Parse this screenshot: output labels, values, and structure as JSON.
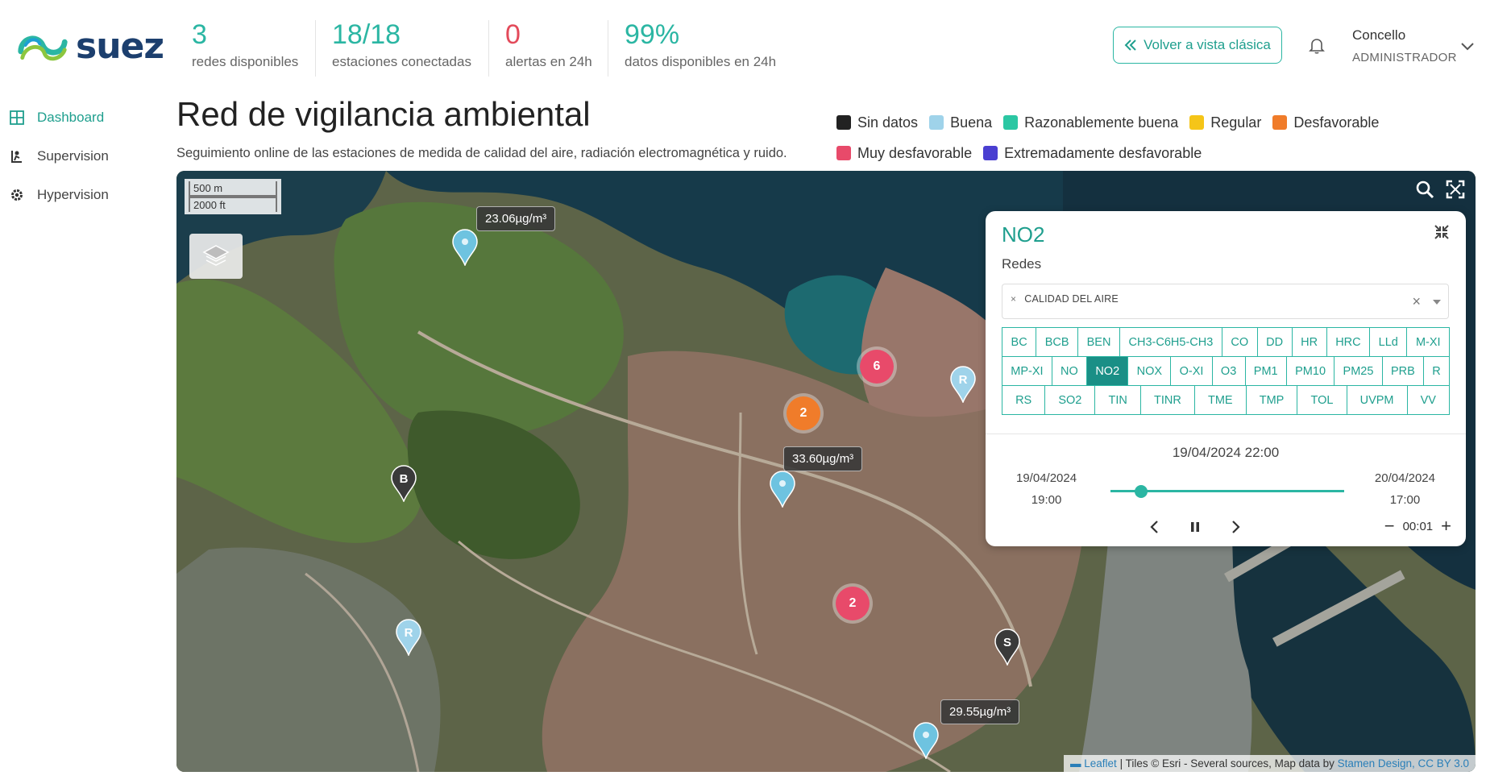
{
  "brand": {
    "name": "suez",
    "color": "#1c3f6e",
    "accent": "#2bb6a3"
  },
  "stats": [
    {
      "value": "3",
      "label": "redes disponibles"
    },
    {
      "value": "18/18",
      "label": "estaciones conectadas"
    },
    {
      "value": "0",
      "label": "alertas en 24h"
    },
    {
      "value": "99%",
      "label": "datos disponibles en 24h"
    }
  ],
  "header": {
    "classic_button": "Volver a vista clásica",
    "user_name": "Concello",
    "user_role": "ADMINISTRADOR"
  },
  "sidebar": {
    "items": [
      {
        "label": "Dashboard",
        "icon": "dashboard-icon",
        "active": true
      },
      {
        "label": "Supervision",
        "icon": "supervision-icon",
        "active": false
      },
      {
        "label": "Hypervision",
        "icon": "gear-icon",
        "active": false
      }
    ]
  },
  "page": {
    "title": "Red de vigilancia ambiental",
    "subtitle": "Seguimiento online de las estaciones de medida de calidad del aire, radiación electromagnética y ruido."
  },
  "legend": {
    "row1": [
      {
        "label": "Sin datos",
        "color": "#222222"
      },
      {
        "label": "Buena",
        "color": "#9fd3ea"
      },
      {
        "label": "Razonablemente buena",
        "color": "#2bc7a3"
      },
      {
        "label": "Regular",
        "color": "#f5c518"
      },
      {
        "label": "Desfavorable",
        "color": "#f07c2a"
      }
    ],
    "row2": [
      {
        "label": "Muy desfavorable",
        "color": "#e84a6a"
      },
      {
        "label": "Extremadamente desfavorable",
        "color": "#4a3fd1"
      }
    ]
  },
  "map": {
    "scale_metric": "500 m",
    "scale_imperial": "2000 ft",
    "attribution": {
      "leaflet": "Leaflet",
      "tiles": "| Tiles © Esri - Several sources, Map data by",
      "stamen": "Stamen Design, CC BY 3.0"
    },
    "clusters": [
      {
        "count": "6",
        "color": "#e84a6a"
      },
      {
        "count": "2",
        "color": "#f07c2a"
      },
      {
        "count": "2",
        "color": "#e84a6a"
      }
    ],
    "pins": [
      {
        "letter": "",
        "color": "#6ec3e0"
      },
      {
        "letter": "",
        "color": "#6ec3e0"
      },
      {
        "letter": "",
        "color": "#6ec3e0"
      },
      {
        "letter": "R",
        "color": "#9fd3ea"
      },
      {
        "letter": "R",
        "color": "#9fd3ea"
      },
      {
        "letter": "B",
        "color": "#3a3a3a"
      },
      {
        "letter": "S",
        "color": "#3a3a3a"
      }
    ],
    "tooltips": [
      "23.06µg/m³",
      "33.60µg/m³",
      "29.55µg/m³"
    ]
  },
  "panel": {
    "title": "NO2",
    "subtitle": "Redes",
    "chip": "CALIDAD DEL AIRE",
    "parameters": [
      [
        "BC",
        "BCB",
        "BEN",
        "CH3-C6H5-CH3",
        "CO",
        "DD",
        "HR",
        "HRC",
        "LLd",
        "M-XI"
      ],
      [
        "MP-XI",
        "NO",
        "NO2",
        "NOX",
        "O-XI",
        "O3",
        "PM1",
        "PM10",
        "PM25",
        "PRB",
        "R"
      ],
      [
        "RS",
        "SO2",
        "TIN",
        "TINR",
        "TME",
        "TMP",
        "TOL",
        "UVPM",
        "VV"
      ]
    ],
    "selected_parameter": "NO2",
    "time_current": "19/04/2024 22:00",
    "time_start_date": "19/04/2024",
    "time_start_hour": "19:00",
    "time_end_date": "20/04/2024",
    "time_end_hour": "17:00",
    "time_progress": 0.13,
    "speed": "00:01"
  }
}
